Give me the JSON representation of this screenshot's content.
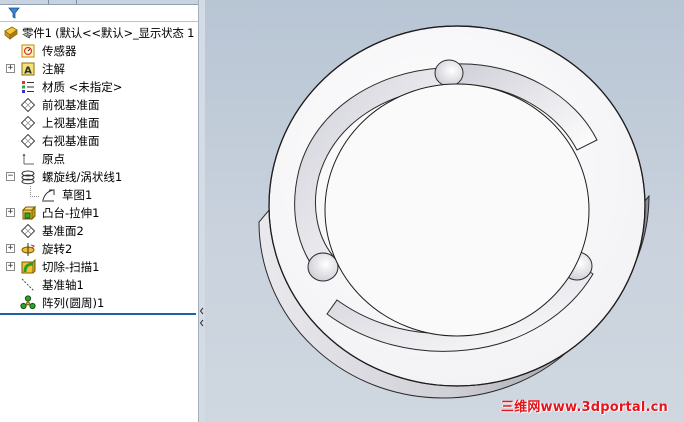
{
  "feature_tree": {
    "root_label": "零件1 (默认<<默认>_显示状态 1",
    "items": [
      {
        "label": "传感器",
        "icon": "sensor-icon",
        "expandable": false
      },
      {
        "label": "注解",
        "icon": "annotation-icon",
        "expandable": true,
        "expander": "+"
      },
      {
        "label": "材质 <未指定>",
        "icon": "material-icon",
        "expandable": false
      },
      {
        "label": "前视基准面",
        "icon": "plane-icon",
        "expandable": false
      },
      {
        "label": "上视基准面",
        "icon": "plane-icon",
        "expandable": false
      },
      {
        "label": "右视基准面",
        "icon": "plane-icon",
        "expandable": false
      },
      {
        "label": "原点",
        "icon": "origin-icon",
        "expandable": false
      },
      {
        "label": "螺旋线/涡状线1",
        "icon": "helix-icon",
        "expandable": true,
        "expander": "−"
      },
      {
        "label": "草图1",
        "icon": "sketch-icon",
        "expandable": false
      },
      {
        "label": "凸台-拉伸1",
        "icon": "extrude-boss-icon",
        "expandable": true,
        "expander": "+"
      },
      {
        "label": "基准面2",
        "icon": "plane-icon",
        "expandable": false
      },
      {
        "label": "旋转2",
        "icon": "revolve-icon",
        "expandable": true,
        "expander": "+"
      },
      {
        "label": "切除-扫描1",
        "icon": "sweep-cut-icon",
        "expandable": true,
        "expander": "+"
      },
      {
        "label": "基准轴1",
        "icon": "axis-icon",
        "expandable": false
      },
      {
        "label": "阵列(圆周)1",
        "icon": "circular-pattern-icon",
        "expandable": false
      }
    ]
  },
  "filter": {
    "icon": "filter-icon"
  },
  "viewport": {
    "watermark": "三维网www.3dportal.cn"
  },
  "colors": {
    "viewport_bg": "#c3cdd9",
    "watermark": "#e8141b",
    "selection_line": "#1f5fb0"
  }
}
